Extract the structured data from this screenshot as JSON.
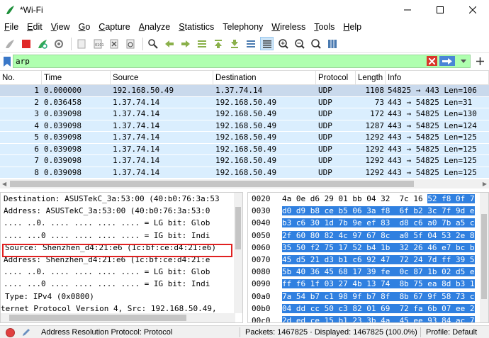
{
  "window": {
    "title": "*Wi-Fi"
  },
  "menu": [
    {
      "label": "File",
      "accel": "F",
      "rest": "ile"
    },
    {
      "label": "Edit",
      "accel": "E",
      "rest": "dit"
    },
    {
      "label": "View",
      "accel": "V",
      "rest": "iew"
    },
    {
      "label": "Go",
      "accel": "G",
      "rest": "o"
    },
    {
      "label": "Capture",
      "accel": "C",
      "rest": "apture"
    },
    {
      "label": "Analyze",
      "accel": "A",
      "rest": "nalyze"
    },
    {
      "label": "Statistics",
      "accel": "S",
      "rest": "tatistics"
    },
    {
      "label": "Telephony",
      "accel": "",
      "rest": "Telephony"
    },
    {
      "label": "Wireless",
      "accel": "W",
      "rest": "ireless"
    },
    {
      "label": "Tools",
      "accel": "T",
      "rest": "ools"
    },
    {
      "label": "Help",
      "accel": "H",
      "rest": "elp"
    }
  ],
  "toolbar": [
    "shark-fin-start-icon",
    "stop-capture-icon",
    "restart-capture-icon",
    "capture-options-icon",
    "open-file-icon",
    "save-file-icon",
    "close-file-icon",
    "reload-file-icon",
    "find-packet-icon",
    "go-back-icon",
    "go-forward-icon",
    "go-to-packet-icon",
    "go-first-icon",
    "go-last-icon",
    "auto-scroll-icon",
    "colorize-icon",
    "zoom-in-icon",
    "zoom-out-icon",
    "zoom-normal-icon",
    "resize-columns-icon"
  ],
  "filter": {
    "value": "arp",
    "bg_color": "#afffaf"
  },
  "packet_list": {
    "headers": [
      "No.",
      "Time",
      "Source",
      "Destination",
      "Protocol",
      "Length",
      "Info"
    ],
    "rows": [
      {
        "no": "1",
        "time": "0.000000",
        "src": "192.168.50.49",
        "dst": "1.37.74.14",
        "proto": "UDP",
        "len": "1108",
        "info": "54825 → 443  Len=106"
      },
      {
        "no": "2",
        "time": "0.036458",
        "src": "1.37.74.14",
        "dst": "192.168.50.49",
        "proto": "UDP",
        "len": "73",
        "info": "443 → 54825  Len=31"
      },
      {
        "no": "3",
        "time": "0.039098",
        "src": "1.37.74.14",
        "dst": "192.168.50.49",
        "proto": "UDP",
        "len": "172",
        "info": "443 → 54825  Len=130"
      },
      {
        "no": "4",
        "time": "0.039098",
        "src": "1.37.74.14",
        "dst": "192.168.50.49",
        "proto": "UDP",
        "len": "1287",
        "info": "443 → 54825  Len=124"
      },
      {
        "no": "5",
        "time": "0.039098",
        "src": "1.37.74.14",
        "dst": "192.168.50.49",
        "proto": "UDP",
        "len": "1292",
        "info": "443 → 54825  Len=125"
      },
      {
        "no": "6",
        "time": "0.039098",
        "src": "1.37.74.14",
        "dst": "192.168.50.49",
        "proto": "UDP",
        "len": "1292",
        "info": "443 → 54825  Len=125"
      },
      {
        "no": "7",
        "time": "0.039098",
        "src": "1.37.74.14",
        "dst": "192.168.50.49",
        "proto": "UDP",
        "len": "1292",
        "info": "443 → 54825  Len=125"
      },
      {
        "no": "8",
        "time": "0.039098",
        "src": "1.37.74.14",
        "dst": "192.168.50.49",
        "proto": "UDP",
        "len": "1292",
        "info": "443 → 54825  Len=125"
      }
    ]
  },
  "details": [
    "Destination: ASUSTekC_3a:53:00 (40:b0:76:3a:53",
    "    Address: ASUSTekC_3a:53:00 (40:b0:76:3a:53:0",
    "    .... ..0. .... .... .... .... = LG bit: Glob",
    "    .... ...0 .... .... .... .... = IG bit: Indi",
    "Source: Shenzhen_d4:21:e6 (1c:bf:ce:d4:21:e6)",
    "    Address: Shenzhen_d4:21:e6 (1c:bf:ce:d4:21:e",
    "    .... ..0. .... .... .... .... = LG bit: Glob",
    "    .... ...0 .... .... .... .... = IG bit: Indi",
    "Type: IPv4 (0x0800)",
    "ternet Protocol Version 4, Src: 192.168.50.49,"
  ],
  "bytes": [
    {
      "off": "0020",
      "plain": "4a 0e d6 29 01 bb 04 32  7c 16 ",
      "sel": "52 f8 0f 7"
    },
    {
      "off": "0030",
      "plain": "",
      "sel": "d0 d9 b8 ce b5 06 3a f8  6f b2 3c 7f 9d e"
    },
    {
      "off": "0040",
      "plain": "",
      "sel": "b3 c6 30 1d 7b 9e ef 83  d8 c6 a0 7b a5 c"
    },
    {
      "off": "0050",
      "plain": "",
      "sel": "2f 60 80 82 4c 97 67 8c  a0 5f 04 53 2e 8"
    },
    {
      "off": "0060",
      "plain": "",
      "sel": "35 50 f2 75 17 52 b4 1b  32 26 46 e7 bc b"
    },
    {
      "off": "0070",
      "plain": "",
      "sel": "45 d5 21 d3 b1 c6 92 47  72 24 7d ff 39 5"
    },
    {
      "off": "0080",
      "plain": "",
      "sel": "5b 40 36 45 68 17 39 fe  0c 87 1b 02 d5 e"
    },
    {
      "off": "0090",
      "plain": "",
      "sel": "ff f6 1f 03 27 4b 13 74  8b 75 ea 8d b3 1"
    },
    {
      "off": "00a0",
      "plain": "",
      "sel": "7a 54 b7 c1 98 9f b7 8f  8b 67 9f 58 73 c"
    },
    {
      "off": "00b0",
      "plain": "",
      "sel": "04 dd cc 50 c3 82 01 69  72 fa 6b 07 ee 2"
    },
    {
      "off": "00c0",
      "plain": "",
      "sel": "2d ed ce 15 b1 23 3b 4a  45 ee 93 84 ac 7"
    }
  ],
  "status": {
    "protocol_text": "Address Resolution Protocol: Protocol",
    "packets_text": "Packets: 1467825 · Displayed: 1467825 (100.0%)",
    "profile_text": "Profile: Default"
  }
}
